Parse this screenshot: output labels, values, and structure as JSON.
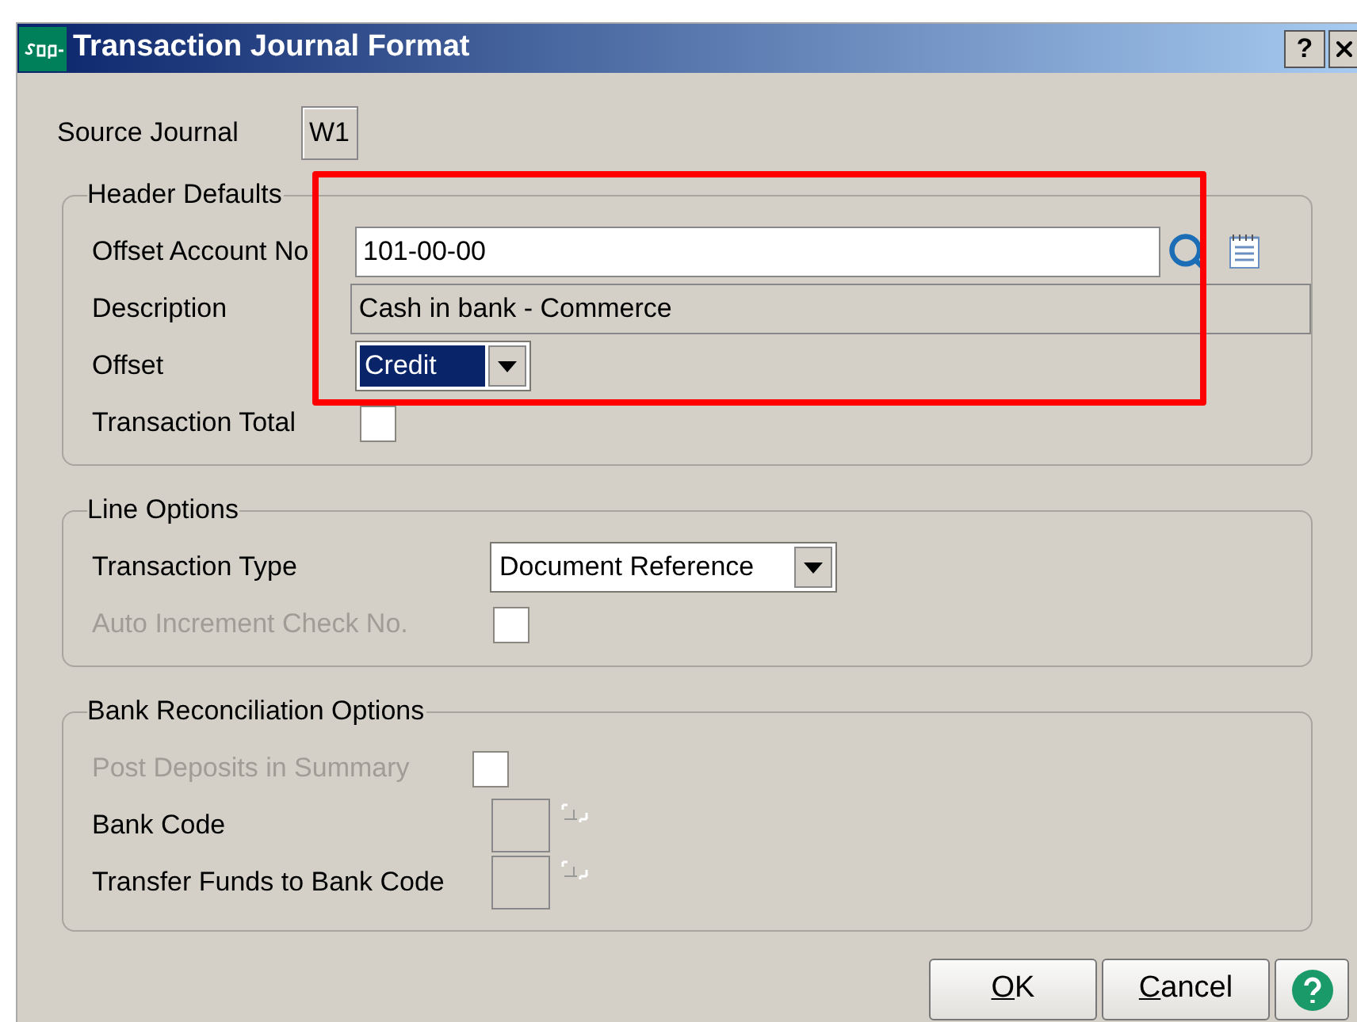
{
  "window": {
    "title": "Transaction Journal Format",
    "help_button": "?"
  },
  "source_journal": {
    "label": "Source Journal",
    "value": "W1"
  },
  "header_defaults": {
    "title": "Header Defaults",
    "offset_account": {
      "label": "Offset Account No",
      "value": "101-00-00"
    },
    "description": {
      "label": "Description",
      "value": "Cash in bank - Commerce"
    },
    "offset": {
      "label": "Offset",
      "value": "Credit"
    },
    "transaction_total": {
      "label": "Transaction Total",
      "checked": false
    }
  },
  "line_options": {
    "title": "Line Options",
    "transaction_type": {
      "label": "Transaction Type",
      "value": "Document Reference"
    },
    "auto_increment": {
      "label": "Auto Increment Check No.",
      "checked": false,
      "disabled": true
    }
  },
  "bank_options": {
    "title": "Bank Reconciliation Options",
    "post_deposits": {
      "label": "Post Deposits in Summary",
      "checked": false,
      "disabled": true
    },
    "bank_code": {
      "label": "Bank Code"
    },
    "transfer_code": {
      "label": "Transfer Funds to Bank Code"
    }
  },
  "buttons": [
    "OK",
    "Cancel"
  ],
  "highlight": {
    "shown": true
  }
}
